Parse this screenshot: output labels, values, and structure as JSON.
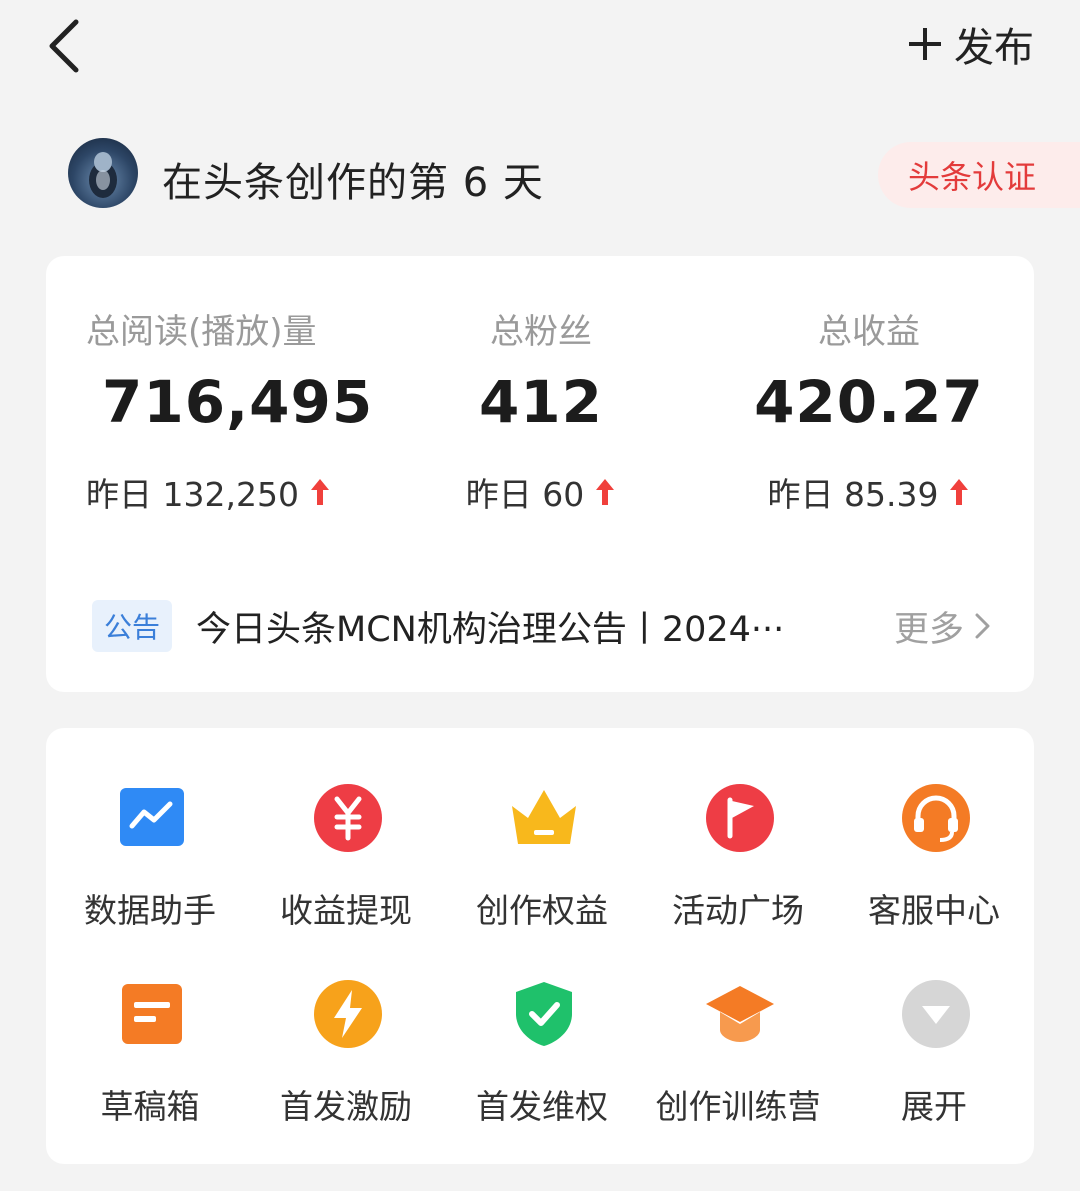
{
  "header": {
    "publish_label": "发布"
  },
  "user": {
    "days_text": "在头条创作的第 6 天",
    "cert_label": "头条认证"
  },
  "stats": {
    "reads": {
      "label": "总阅读(播放)量",
      "value": "716,495",
      "yesterday": "昨日 132,250"
    },
    "fans": {
      "label": "总粉丝",
      "value": "412",
      "yesterday": "昨日 60"
    },
    "income": {
      "label": "总收益",
      "value": "420.27",
      "yesterday": "昨日 85.39"
    }
  },
  "notice": {
    "tag": "公告",
    "text": "今日头条MCN机构治理公告丨2024···",
    "more_label": "更多"
  },
  "tools": [
    {
      "label": "数据助手",
      "icon": "data-chart-icon"
    },
    {
      "label": "收益提现",
      "icon": "yuan-icon"
    },
    {
      "label": "创作权益",
      "icon": "crown-icon"
    },
    {
      "label": "活动广场",
      "icon": "flag-icon"
    },
    {
      "label": "客服中心",
      "icon": "headset-icon"
    },
    {
      "label": "草稿箱",
      "icon": "draft-icon"
    },
    {
      "label": "首发激励",
      "icon": "lightning-icon"
    },
    {
      "label": "首发维权",
      "icon": "shield-check-icon"
    },
    {
      "label": "创作训练营",
      "icon": "graduation-cap-icon"
    },
    {
      "label": "展开",
      "icon": "expand-down-icon"
    }
  ],
  "colors": {
    "accent_red": "#e33b3b",
    "up_arrow": "#f0403c",
    "notice_blue": "#3b7fd9"
  }
}
